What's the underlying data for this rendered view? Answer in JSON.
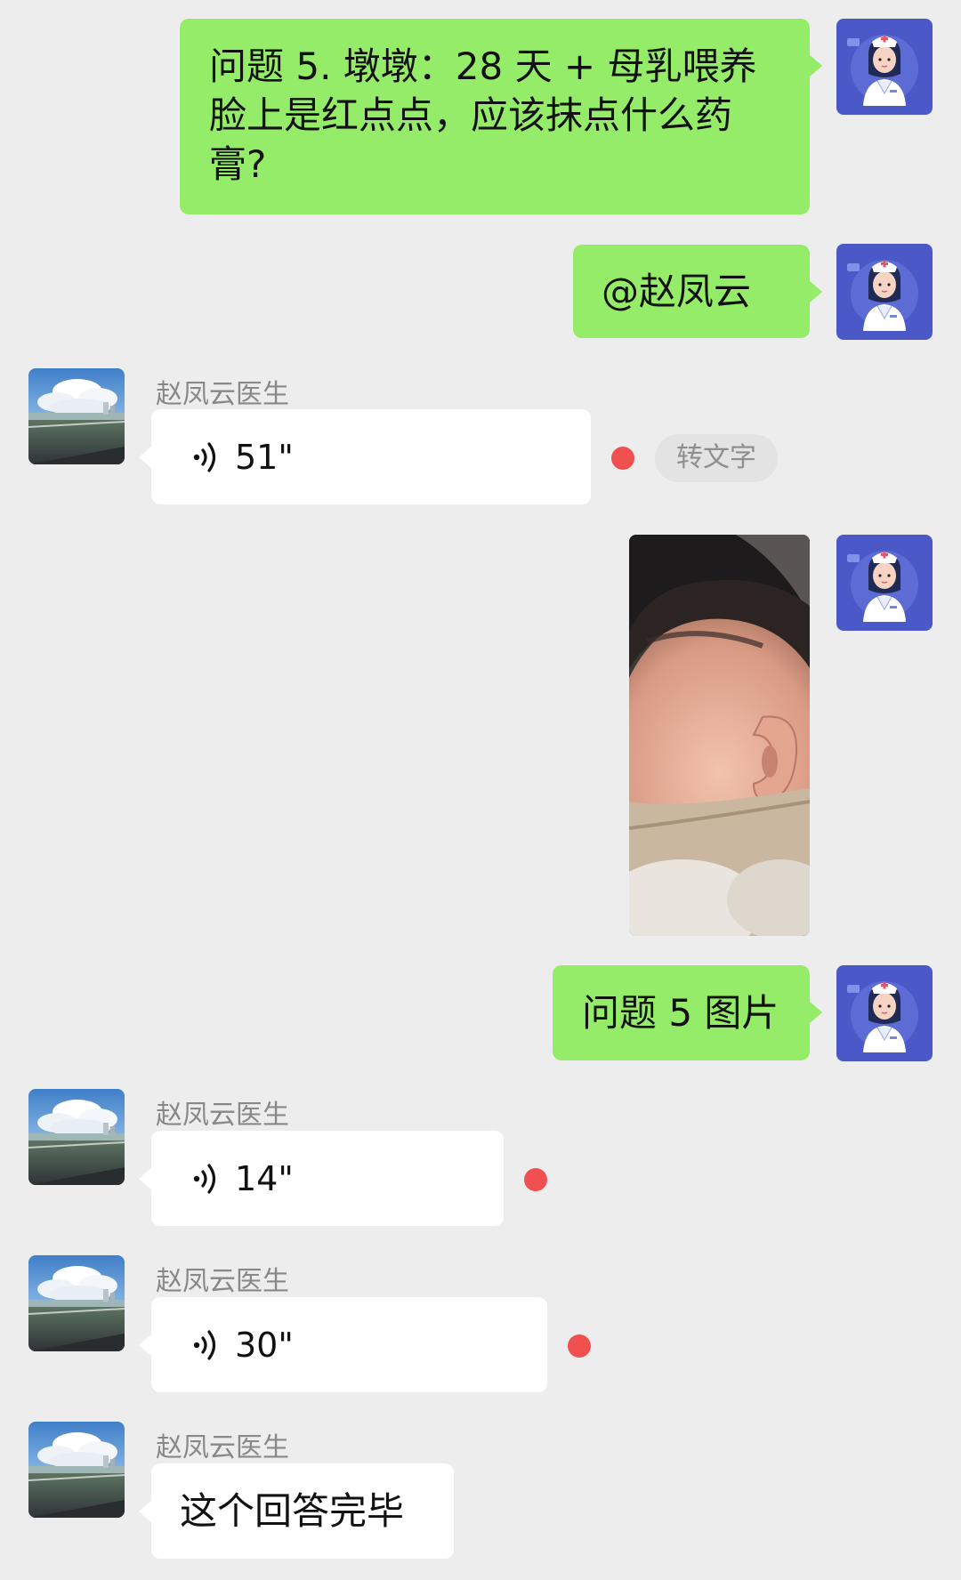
{
  "messages": {
    "q5_text": "问题 5. 墩墩：28 天 + 母乳喂养 脸上是红点点，应该抹点什么药膏?",
    "mention": "@赵凤云",
    "doctor_name": "赵凤云医生",
    "voice1_duration": "51\"",
    "to_text_label": "转文字",
    "q5_image_caption": "问题 5 图片",
    "voice2_duration": "14\"",
    "voice3_duration": "30\"",
    "final_reply": "这个回答完毕"
  },
  "colors": {
    "sent_bubble": "#95ec69",
    "received_bubble": "#ffffff",
    "background": "#ededed",
    "unread_dot": "#f0504f",
    "self_avatar": "#4a58c8"
  },
  "icons": {
    "voice": "voice-wave-icon",
    "self_avatar": "nurse-avatar",
    "doctor_avatar": "sky-clouds-avatar"
  }
}
